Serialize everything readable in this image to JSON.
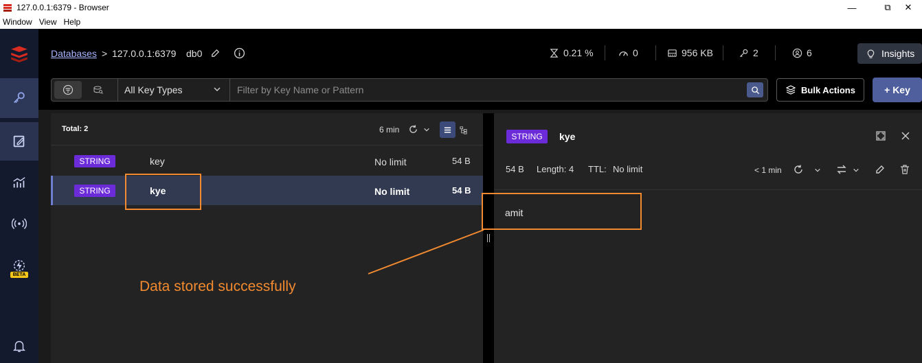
{
  "window": {
    "title": "127.0.0.1:6379 - Browser",
    "menu": [
      "Window",
      "View",
      "Help"
    ]
  },
  "nav": {
    "beta_label": "BETA"
  },
  "header": {
    "breadcrumb_root": "Databases",
    "breadcrumb_sep": ">",
    "host": "127.0.0.1:6379",
    "db": "db0",
    "stats": {
      "cpu": "0.21 %",
      "ops": "0",
      "memory": "956 KB",
      "keys": "2",
      "clients": "6"
    },
    "insights_label": "Insights"
  },
  "filter": {
    "key_type": "All Key Types",
    "placeholder": "Filter by Key Name or Pattern",
    "bulk_actions_label": "Bulk Actions",
    "add_key_label": "+ Key"
  },
  "list": {
    "total_label": "Total: 2",
    "refresh_age": "6 min",
    "rows": [
      {
        "type": "STRING",
        "name": "key",
        "ttl": "No limit",
        "size": "54 B",
        "selected": false
      },
      {
        "type": "STRING",
        "name": "kye",
        "ttl": "No limit",
        "size": "54 B",
        "selected": true
      }
    ]
  },
  "detail": {
    "type": "STRING",
    "name": "kye",
    "size": "54 B",
    "length": "Length: 4",
    "ttl_label": "TTL:",
    "ttl_value": "No limit",
    "refresh_age": "< 1 min",
    "value": "amit"
  },
  "annotation": {
    "text": "Data stored successfully",
    "color": "#f28a30"
  },
  "colors": {
    "badge_string": "#6c2bd9",
    "accent": "#4f5f9e",
    "nav_bg": "#131a2e"
  }
}
